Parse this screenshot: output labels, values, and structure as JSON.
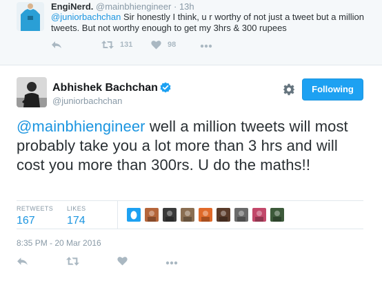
{
  "parent_tweet": {
    "name": "EngiNerd.",
    "handle": "@mainbhiengineer",
    "separator": "·",
    "time": "13h",
    "mention": "@juniorbachchan",
    "text": " Sir honestly I think, u r worthy of not just a tweet but a million tweets. But not worthy enough to get my 3hrs & 300 rupees",
    "retweet_count": "131",
    "like_count": "98"
  },
  "main_tweet": {
    "author_name": "Abhishek Bachchan",
    "author_handle": "@juniorbachchan",
    "follow_label": "Following",
    "mention": "@mainbhiengineer",
    "text": " well a million tweets will most probably take you a lot more than 3 hrs and will cost you more than 300rs. U do the maths!!",
    "retweets_label": "RETWEETS",
    "retweets_count": "167",
    "likes_label": "LIKES",
    "likes_count": "174",
    "timestamp": "8:35 PM - 20 Mar 2016"
  },
  "colors": {
    "link": "#1b95e0",
    "follow_button": "#1da1f2",
    "icon_gray": "#aab8c2",
    "muted_text": "#8899a6",
    "verified": "#1da1f2"
  },
  "icons": [
    "reply-icon",
    "retweet-icon",
    "heart-icon",
    "more-icon",
    "gear-icon",
    "verified-badge-icon"
  ],
  "liker_avatars": [
    {
      "color": "#1da1f2",
      "kind": "egg"
    },
    {
      "color": "#b5653a",
      "kind": "photo"
    },
    {
      "color": "#3a3a3a",
      "kind": "photo"
    },
    {
      "color": "#8a6e52",
      "kind": "photo"
    },
    {
      "color": "#e06a2a",
      "kind": "photo"
    },
    {
      "color": "#5a3b2a",
      "kind": "photo"
    },
    {
      "color": "#6a6a6a",
      "kind": "photo"
    },
    {
      "color": "#c2486a",
      "kind": "photo"
    },
    {
      "color": "#3d5a3a",
      "kind": "photo"
    }
  ]
}
